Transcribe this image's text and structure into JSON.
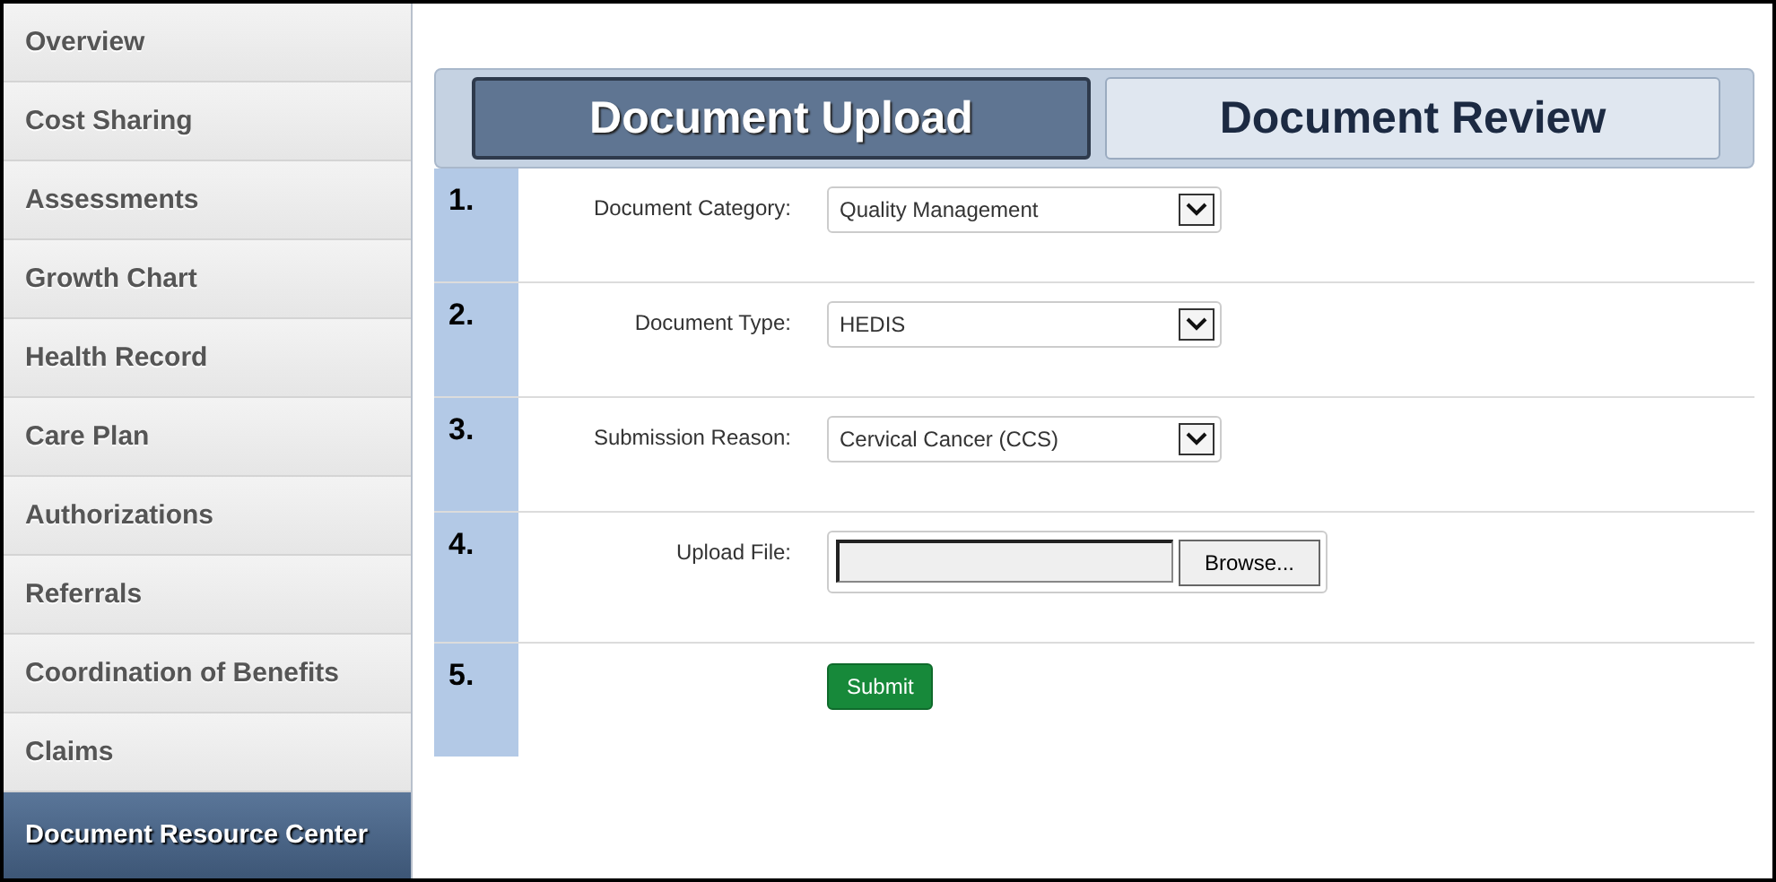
{
  "sidebar": {
    "items": [
      {
        "label": "Overview",
        "selected": false
      },
      {
        "label": "Cost Sharing",
        "selected": false
      },
      {
        "label": "Assessments",
        "selected": false
      },
      {
        "label": "Growth Chart",
        "selected": false
      },
      {
        "label": "Health Record",
        "selected": false
      },
      {
        "label": "Care Plan",
        "selected": false
      },
      {
        "label": "Authorizations",
        "selected": false
      },
      {
        "label": "Referrals",
        "selected": false
      },
      {
        "label": "Coordination of Benefits",
        "selected": false
      },
      {
        "label": "Claims",
        "selected": false
      },
      {
        "label": "Document Resource Center",
        "selected": true
      }
    ]
  },
  "tabs": [
    {
      "label": "Document Upload",
      "selected": true
    },
    {
      "label": "Document Review",
      "selected": false
    }
  ],
  "steps": [
    {
      "number": "1.",
      "kind": "select",
      "label": "Document Category:",
      "value": "Quality Management"
    },
    {
      "number": "2.",
      "kind": "select",
      "label": "Document Type:",
      "value": "HEDIS"
    },
    {
      "number": "3.",
      "kind": "select",
      "label": "Submission Reason:",
      "value": "Cervical Cancer (CCS)"
    },
    {
      "number": "4.",
      "kind": "file",
      "label": "Upload File:",
      "button": "Browse..."
    },
    {
      "number": "5.",
      "kind": "submit",
      "button": "Submit"
    }
  ]
}
